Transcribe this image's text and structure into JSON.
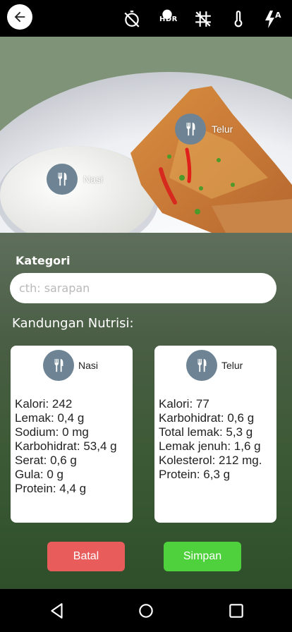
{
  "camera_bar": {
    "back_icon": "arrow-left-icon",
    "icons": [
      "timer-off-icon",
      "hdr-icon",
      "grid-off-icon",
      "thermometer-icon",
      "flash-auto-icon"
    ],
    "hdr_label": "HDR",
    "flash_label": "A"
  },
  "photo_tags": [
    {
      "label": "Telur",
      "icon": "fork-knife-icon"
    },
    {
      "label": "Nasi",
      "icon": "fork-knife-icon"
    }
  ],
  "category": {
    "label": "Kategori",
    "placeholder": "cth: sarapan",
    "value": ""
  },
  "nutrition": {
    "title": "Kandungan Nutrisi:",
    "cards": [
      {
        "name": "Nasi",
        "lines": [
          "Kalori: 242",
          "Lemak: 0,4 g",
          "Sodium: 0 mg",
          "Karbohidrat: 53,4 g",
          "Serat: 0,6 g",
          "Gula: 0 g",
          "Protein: 4,4 g"
        ]
      },
      {
        "name": "Telur",
        "lines": [
          "Kalori: 77",
          "Karbohidrat: 0,6 g",
          "Total lemak: 5,3 g",
          "Lemak jenuh: 1,6 g",
          "Kolesterol: 212 mg.",
          "Protein: 6,3 g"
        ]
      }
    ]
  },
  "buttons": {
    "cancel_label": "Batal",
    "save_label": "Simpan",
    "cancel_color": "#e85c5c",
    "save_color": "#4fd13d"
  },
  "nav": {
    "icons": [
      "back-triangle-icon",
      "home-circle-icon",
      "recents-square-icon"
    ]
  }
}
